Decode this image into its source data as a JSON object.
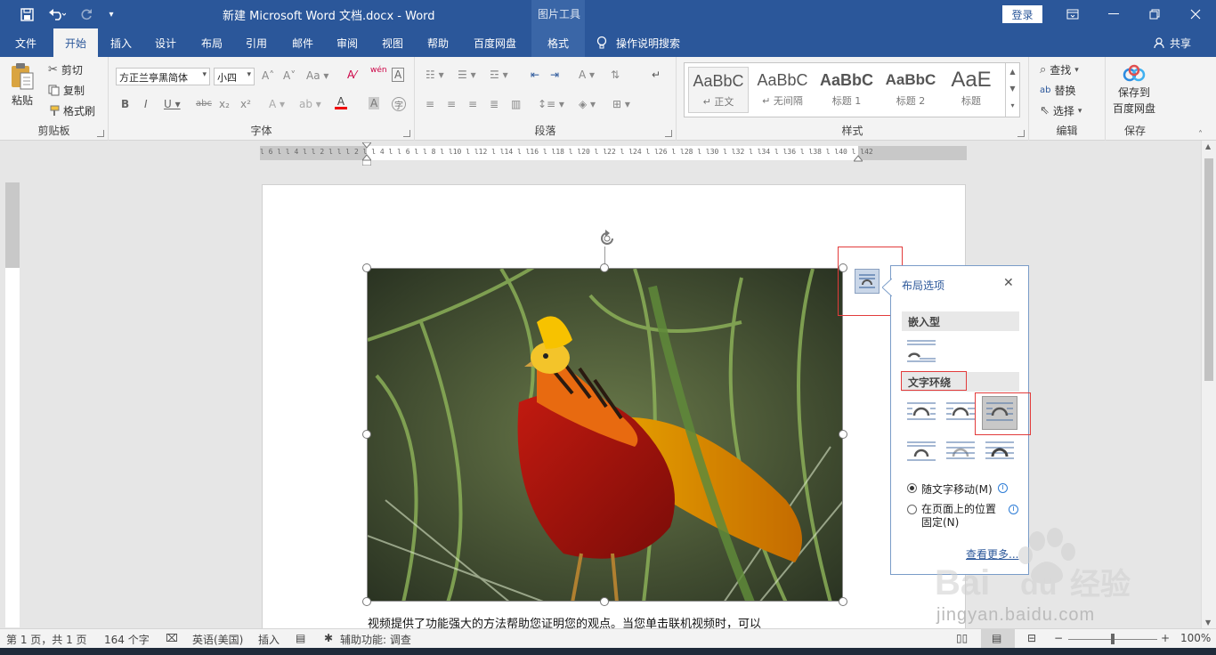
{
  "titlebar": {
    "doc_title": "新建 Microsoft Word 文档.docx  -  Word",
    "context_tools": "图片工具",
    "login": "登录",
    "save_icon": "save-icon",
    "undo_icon": "undo-icon",
    "redo_icon": "redo-icon"
  },
  "tabs": [
    "文件",
    "开始",
    "插入",
    "设计",
    "布局",
    "引用",
    "邮件",
    "审阅",
    "视图",
    "帮助",
    "百度网盘",
    "格式"
  ],
  "tell_me": "操作说明搜索",
  "share": "共享",
  "ribbon": {
    "clipboard": {
      "paste": "粘贴",
      "cut": "剪切",
      "copy": "复制",
      "format_painter": "格式刷",
      "label": "剪贴板"
    },
    "font": {
      "font_name": "方正兰亭黑简体",
      "font_size": "小四",
      "label": "字体"
    },
    "paragraph": {
      "label": "段落"
    },
    "styles": {
      "items": [
        {
          "sample": "AaBbC",
          "name": "↵ 正文"
        },
        {
          "sample": "AaBbC",
          "name": "↵ 无间隔"
        },
        {
          "sample": "AaBbC",
          "name": "标题 1"
        },
        {
          "sample": "AaBbC",
          "name": "标题 2"
        },
        {
          "sample": "AaE",
          "name": "标题"
        }
      ],
      "label": "样式"
    },
    "editing": {
      "find": "查找",
      "replace": "替换",
      "select": "选择",
      "label": "编辑"
    },
    "save": {
      "button_line1": "保存到",
      "button_line2": "百度网盘",
      "label": "保存"
    }
  },
  "ruler": {
    "ticks": "l 6 l  l 4 l  l 2 l   l    l 2 l  l 4 l  l 6 l  l 8 l  l10 l  l12 l  l14 l  l16 l  l18 l  l20 l  l22 l  l24 l  l26 l  l28 l  l30 l  l32 l  l34 l  l36 l  l38 l  l40 l  l42",
    "tab_selector": "L"
  },
  "document": {
    "body_text": "视频提供了功能强大的方法帮助您证明您的观点。当您单击联机视频时，可以"
  },
  "layout_popup": {
    "title": "布局选项",
    "close": "✕",
    "inline_section": "嵌入型",
    "wrap_section": "文字环绕",
    "move_with_text": "随文字移动(M)",
    "fix_position_line1": "在页面上的位置",
    "fix_position_line2": "固定(N)",
    "see_more": "查看更多..."
  },
  "statusbar": {
    "page": "第 1 页，共 1 页",
    "words": "164 个字",
    "language": "英语(美国)",
    "mode": "插入",
    "accessibility": "辅助功能: 调查",
    "zoom": "100%"
  },
  "watermark": {
    "text": "jingyan.baidu.com",
    "brand": "Bai",
    "brand2": "du",
    "cn": "经验"
  },
  "colors": {
    "word_blue": "#2b579a",
    "highlight_red": "#e23b3b"
  }
}
